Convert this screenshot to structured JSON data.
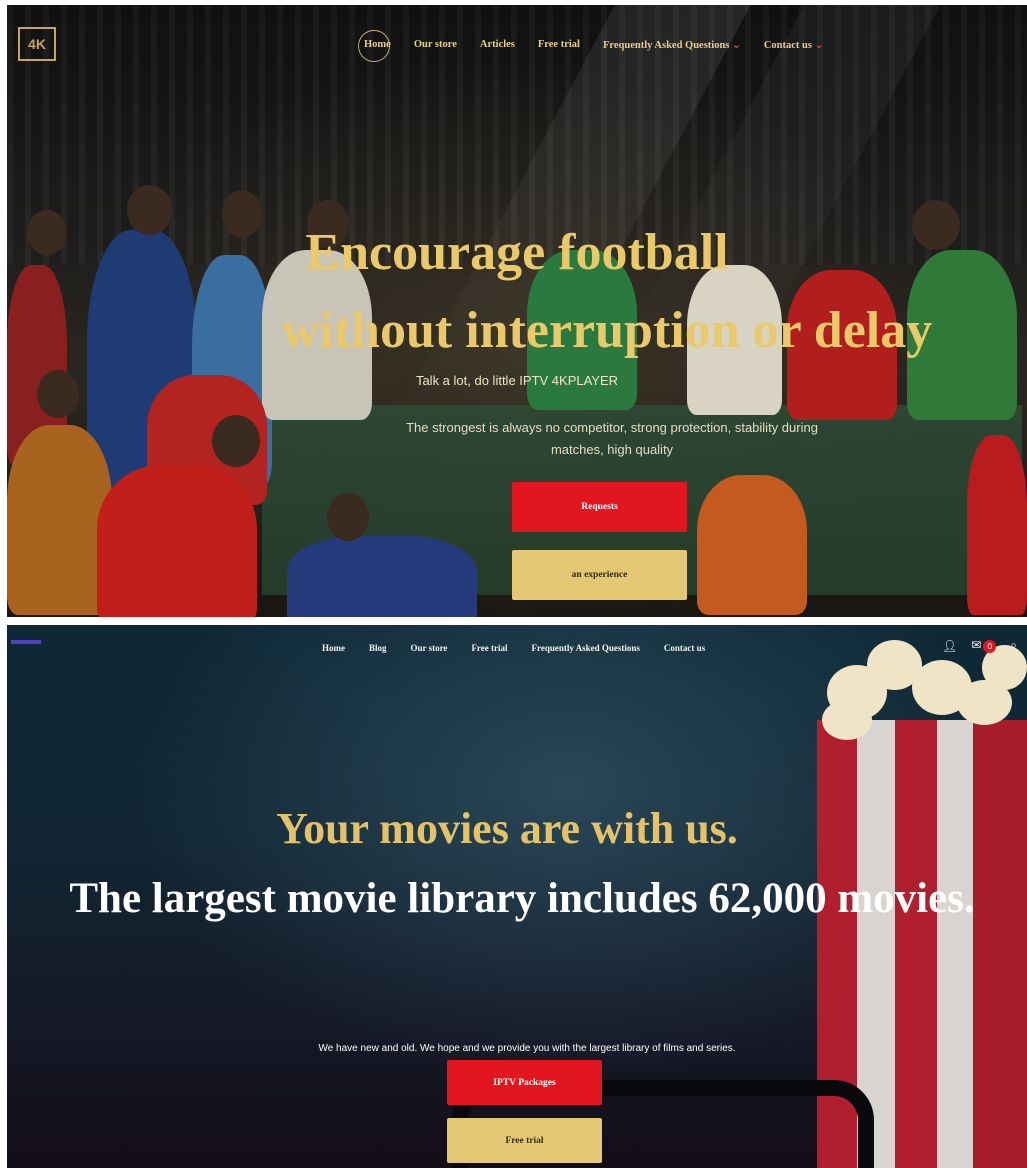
{
  "hero_football": {
    "logo": "4K",
    "nav": [
      "Home",
      "Our store",
      "Articles",
      "Free trial",
      "Frequently Asked Questions",
      "Contact us"
    ],
    "nav_dropdown_marker": "⌄",
    "title_line1": "Encourage football",
    "title_line2": "without interruption or delay",
    "subtitle": "Talk a lot, do little IPTV 4KPLAYER",
    "description": "The strongest is always no competitor, strong protection, stability during matches, high quality",
    "primary_button": "Requests",
    "secondary_button": "an experience"
  },
  "hero_movies": {
    "nav": [
      "Home",
      "Blog",
      "Our store",
      "Free trial",
      "Frequently Asked Questions",
      "Contact us"
    ],
    "cart_count": "0",
    "title_line1": "Your movies are with us.",
    "title_line2": "The largest movie library includes 62,000 movies.",
    "description": "We have new and old. We hope and we provide you with the largest library of films and series.",
    "primary_button": "IPTV Packages",
    "secondary_button": "Free trial"
  },
  "colors": {
    "gold": "#e9c96a",
    "button_red": "#e2161f",
    "button_gold": "#e3c772"
  },
  "icons": [
    "user-icon",
    "cart-icon",
    "search-icon",
    "dropdown-chevron-icon"
  ]
}
